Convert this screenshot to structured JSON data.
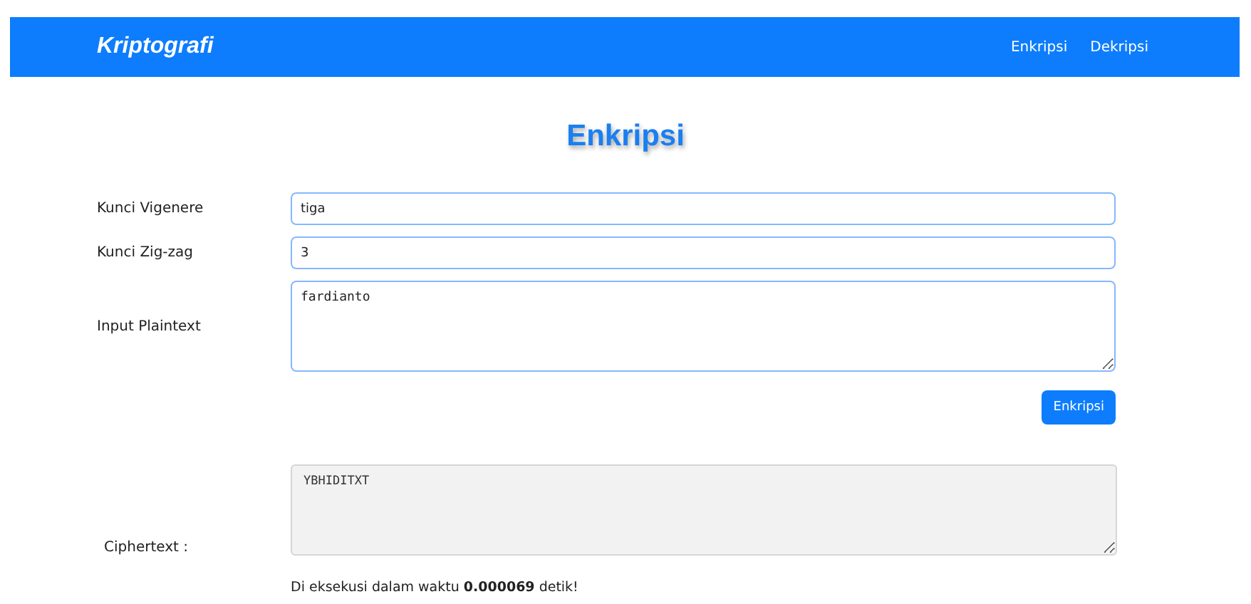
{
  "navbar": {
    "brand": "Kriptografi",
    "links": [
      {
        "label": "Enkripsi"
      },
      {
        "label": "Dekripsi"
      }
    ]
  },
  "title": "Enkripsi",
  "form": {
    "fields": [
      {
        "label": "Kunci Vigenere",
        "kind": "input",
        "value": "tiga"
      },
      {
        "label": "Kunci Zig-zag",
        "kind": "input",
        "value": "3"
      },
      {
        "label": "Input Plaintext",
        "kind": "textarea",
        "value": "fardianto"
      }
    ],
    "submit": "Enkripsi"
  },
  "output": {
    "label": "Ciphertext :",
    "value": "YBHIDITXT",
    "readonly": true
  },
  "result": "Di eksekusi dalam waktu **0.000069** detik!"
}
